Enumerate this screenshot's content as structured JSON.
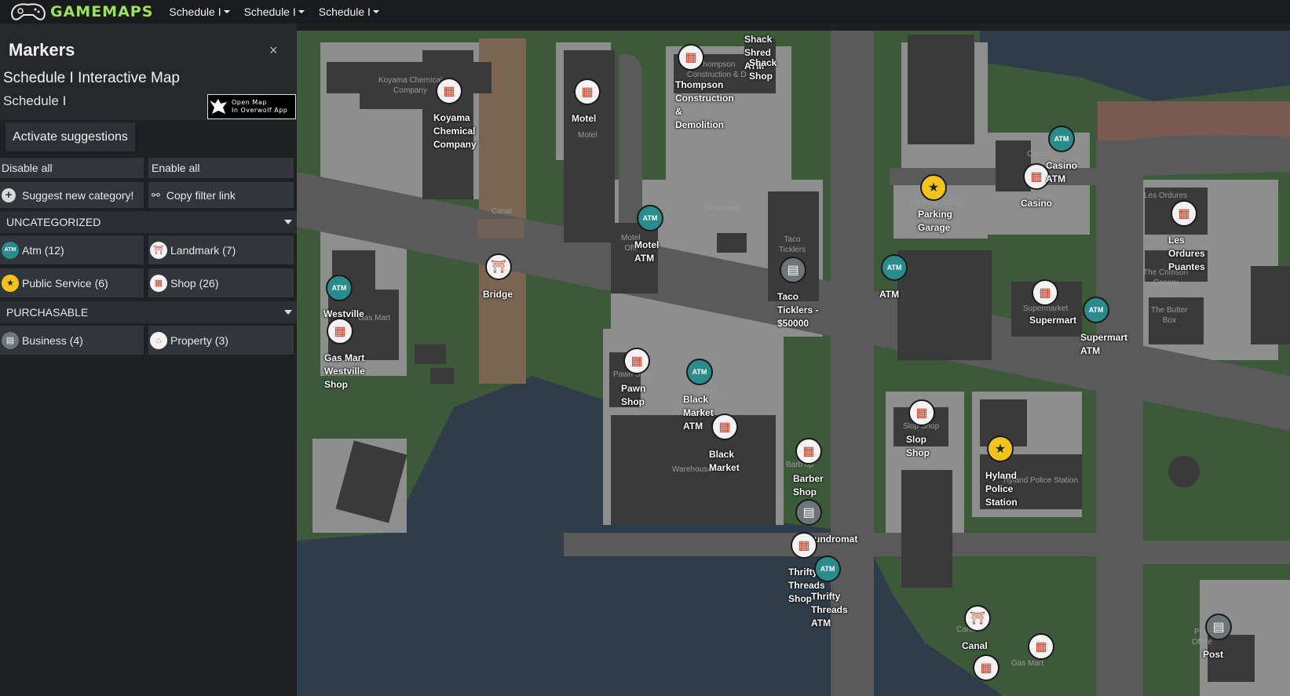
{
  "nav": {
    "logo": "GAMEMAPS",
    "items": [
      "Schedule I",
      "Schedule I",
      "Schedule I"
    ]
  },
  "sidebar": {
    "title": "Markers",
    "close": "×",
    "map_title": "Schedule I Interactive Map",
    "map_subtitle": "Schedule I",
    "overwolf_line1": "Open Map",
    "overwolf_line2": "In Overwolf App",
    "suggest_btn": "Activate suggestions",
    "disable_all": "Disable all",
    "enable_all": "Enable all",
    "suggest_category": "Suggest new category!",
    "copy_filter": "Copy filter link",
    "sections": [
      {
        "name": "UNCATEGORIZED",
        "items": [
          "Atm (12)",
          "Landmark (7)",
          "Public Service (6)",
          "Shop (26)"
        ]
      },
      {
        "name": "PURCHASABLE",
        "items": [
          "Business (4)",
          "Property (3)"
        ]
      }
    ]
  },
  "map": {
    "marker_labels": {
      "koyama": "Koyama\nChemical\nCompany",
      "motel": "Motel",
      "thompson": "Thompson\nConstruction\n&\nDemolition",
      "shack": "Shack\nShred\nATM",
      "shack_shop": "Shack\nShop",
      "casino_atm": "Casino\nATM",
      "casino": "Casino",
      "parking": "Parking\nGarage",
      "les_ordures": "Les\nOrdures\nPuantes",
      "motel_atm": "Motel\nATM",
      "bridge": "Bridge",
      "taco": "Taco\nTicklers -\n$50000",
      "atm": "ATM",
      "supermart": "Supermart",
      "supermart_atm": "Supermart\nATM",
      "westville_atm": "Westville",
      "gas_mart": "Gas Mart\nWestville\nShop",
      "pawn": "Pawn\nShop",
      "black_market_atm": "Black\nMarket\nATM",
      "black_market": "Black\nMarket",
      "slop": "Slop\nShop",
      "hyland": "Hyland\nPolice\nStation",
      "barber": "Barber\nShop",
      "laundromat": "Laundromat",
      "thrifty": "Thrifty\nThreads\nShop",
      "thrifty_atm": "Thrifty\nThreads\nATM",
      "canal": "Canal",
      "post": "Post"
    },
    "building_labels": {
      "koyama": "Koyama Chemical\nCompany",
      "motel": "Motel",
      "thompson": "Thompson\nConstruction & D",
      "casino": "Casino",
      "parking": "Parking Garage",
      "les_ordures": "Les Ordures",
      "canal": "Canal",
      "skatepark": "Skatepark",
      "motel_office": "Motel\nOffi",
      "taco": "Taco\nTicklers",
      "crimson": "The Crimson\nCanary",
      "supermarket": "Supermarket",
      "butter": "The Butter\nBox",
      "gas_mart": "Gas Mart",
      "pawn": "Pawn Shop",
      "liquor": "or\nStore",
      "warehouse": "Warehouse",
      "slop": "Slop Shop",
      "barber": "Barb    op",
      "police": "Hyland Police Station",
      "canal2": "Canal",
      "post": "Post\nOffice",
      "gasmart2": "Gas Mart"
    }
  },
  "colors": {
    "logo_green": "#9be25a",
    "shop": "#d23b22",
    "atm": "#2a8c8a",
    "public_service": "#f2c41b",
    "water": "#2f3d4a",
    "road": "#5a5a5a",
    "grass": "#3c5a3a"
  }
}
